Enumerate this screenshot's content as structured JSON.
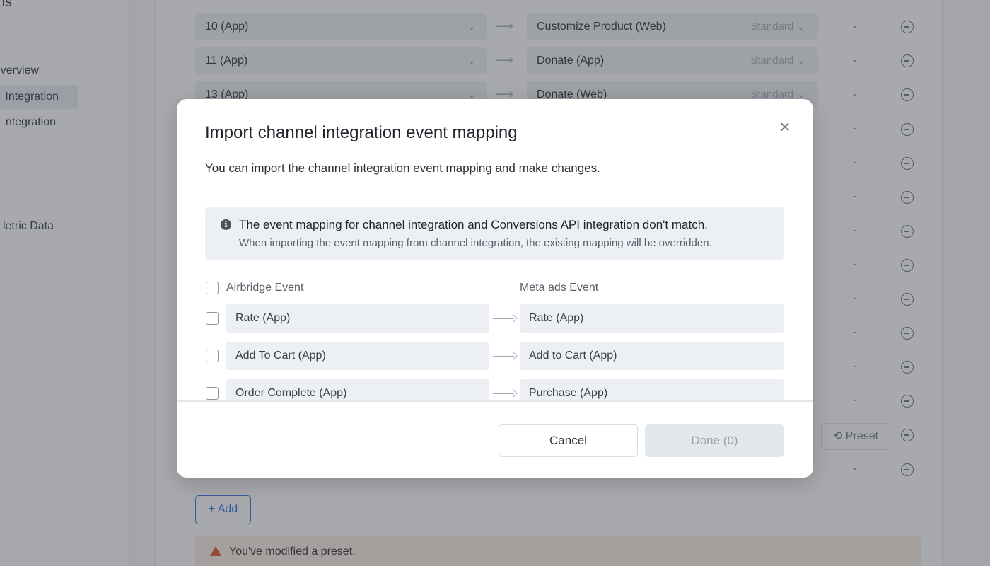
{
  "sidebar": {
    "top_text": "ns",
    "items": [
      {
        "label": "Overview"
      },
      {
        "label": "Integration"
      },
      {
        "label": "ntegration"
      },
      {
        "label": "letric Data"
      }
    ]
  },
  "background_rows": [
    {
      "source": "10 (App)",
      "target": "Customize Product (Web)",
      "type": "Standard",
      "dash": "-"
    },
    {
      "source": "11 (App)",
      "target": "Donate (App)",
      "type": "Standard",
      "dash": "-"
    },
    {
      "source": "13 (App)",
      "target": "Donate (Web)",
      "type": "Standard",
      "dash": "-"
    }
  ],
  "background_extra": {
    "dash": "-",
    "preset_label": "Preset",
    "add_label": "+ Add",
    "warning_text": "You've modified a preset."
  },
  "modal": {
    "title": "Import channel integration event mapping",
    "close_glyph": "×",
    "description": "You can import the channel integration event mapping and make changes.",
    "notice": {
      "title": "The event mapping for channel integration and Conversions API integration don't match.",
      "body": "When importing the event mapping from channel integration, the existing mapping will be overridden."
    },
    "columns": {
      "source": "Airbridge Event",
      "target": "Meta ads Event"
    },
    "rows": [
      {
        "source": "Rate (App)",
        "target": "Rate (App)"
      },
      {
        "source": "Add To Cart (App)",
        "target": "Add to Cart (App)"
      },
      {
        "source": "Order Complete (App)",
        "target": "Purchase (App)"
      }
    ],
    "cancel_label": "Cancel",
    "done_label": "Done (0)"
  },
  "colors": {
    "accent": "#2f6fe0",
    "warning": "#d9572b",
    "overlay": "rgba(60,64,70,0.45)"
  },
  "icons": [
    "info-icon",
    "close-icon",
    "arrow-right-icon",
    "remove-circle-icon",
    "history-icon",
    "warning-icon",
    "chevron-down-icon"
  ]
}
